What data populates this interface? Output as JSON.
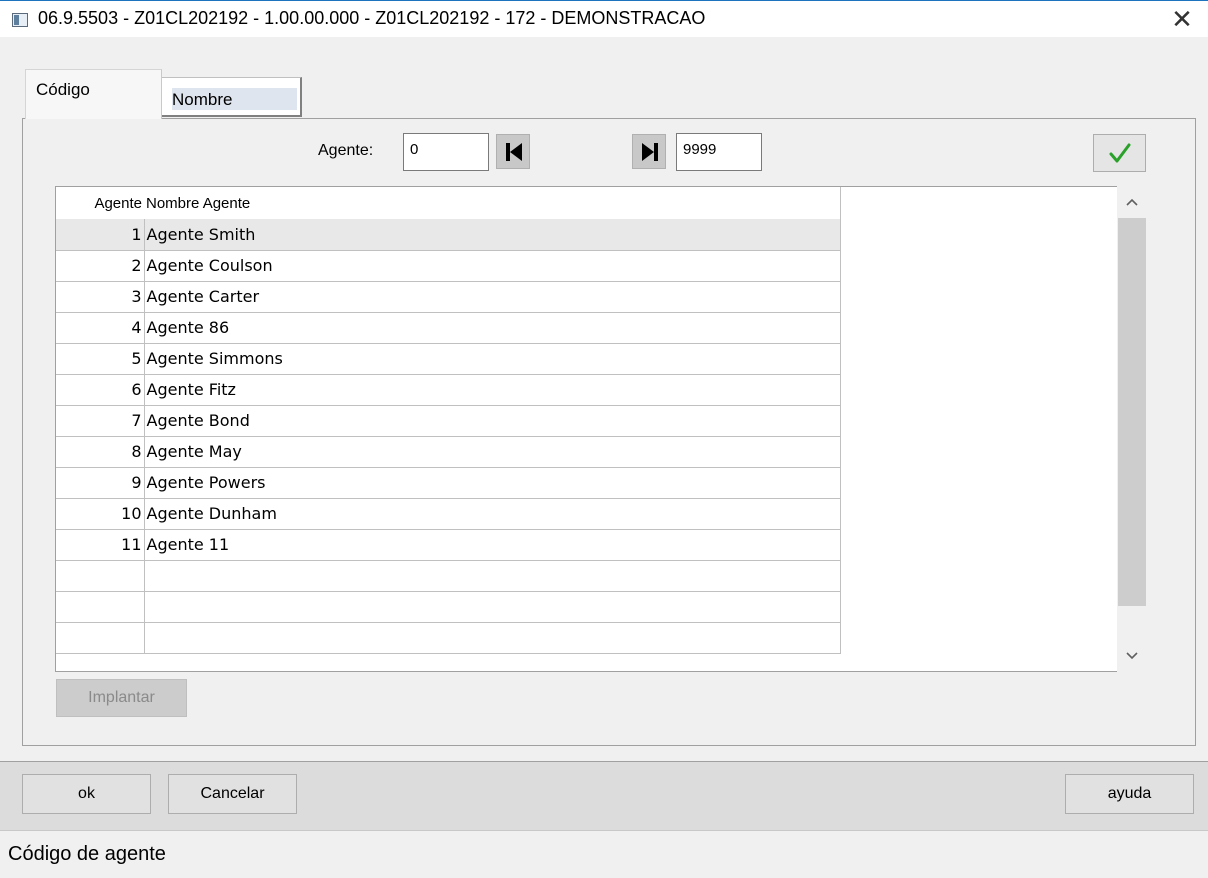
{
  "window": {
    "title": "06.9.5503 - Z01CL202192 - 1.00.00.000 - Z01CL202192 - 172 - DEMONSTRACAO",
    "close_glyph": "✕"
  },
  "tabs": [
    {
      "label": "Código",
      "active": true
    },
    {
      "label": "Nombre",
      "active": false
    }
  ],
  "filter": {
    "label": "Agente:",
    "from_value": "0",
    "to_value": "9999",
    "first_icon": "skip-to-first-icon",
    "last_icon": "skip-to-last-icon",
    "confirm_icon": "green-checkmark-icon"
  },
  "table": {
    "columns": [
      "Agente",
      "Nombre Agente"
    ],
    "rows": [
      {
        "num": "1",
        "name": "Agente Smith"
      },
      {
        "num": "2",
        "name": "Agente Coulson"
      },
      {
        "num": "3",
        "name": "Agente Carter"
      },
      {
        "num": "4",
        "name": "Agente 86"
      },
      {
        "num": "5",
        "name": "Agente Simmons"
      },
      {
        "num": "6",
        "name": "Agente Fitz"
      },
      {
        "num": "7",
        "name": "Agente Bond"
      },
      {
        "num": "8",
        "name": "Agente May"
      },
      {
        "num": "9",
        "name": "Agente Powers"
      },
      {
        "num": "10",
        "name": "Agente Dunham"
      },
      {
        "num": "11",
        "name": "Agente 11"
      },
      {
        "num": "",
        "name": ""
      },
      {
        "num": "",
        "name": ""
      },
      {
        "num": "",
        "name": ""
      }
    ],
    "selected_row": 0
  },
  "buttons": {
    "implantar": "Implantar",
    "ok": "ok",
    "cancel": "Cancelar",
    "help": "ayuda"
  },
  "status": {
    "text": "Código de agente"
  },
  "colors": {
    "accent_border": "#1e73be",
    "check_green": "#2aa12a"
  }
}
